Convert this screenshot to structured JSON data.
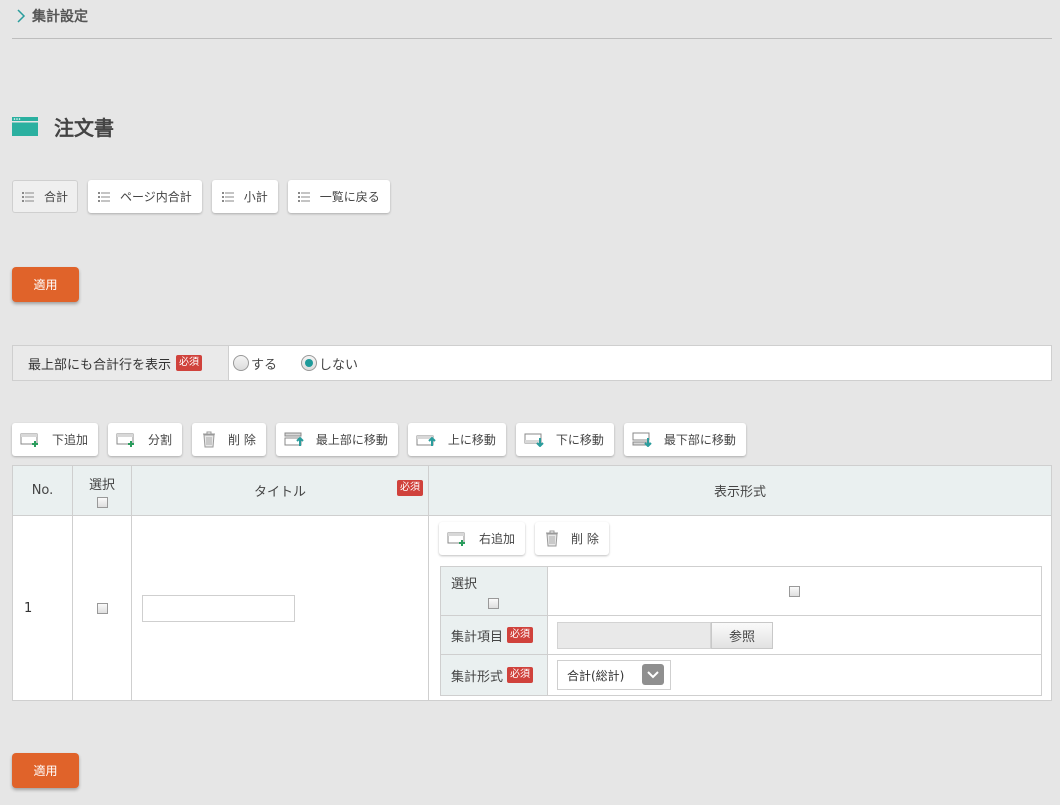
{
  "breadcrumb": {
    "label": "集計設定"
  },
  "page": {
    "title": "注文書"
  },
  "tabs": [
    {
      "label": "合計"
    },
    {
      "label": "ページ内合計"
    },
    {
      "label": "小計"
    },
    {
      "label": "一覧に戻る"
    }
  ],
  "apply_label": "適用",
  "required_label": "必須",
  "setting": {
    "label": "最上部にも合計行を表示",
    "options": [
      "する",
      "しない"
    ],
    "selected": "しない"
  },
  "toolbar": {
    "add_below": "下追加",
    "split": "分割",
    "delete": "削 除",
    "move_top": "最上部に移動",
    "move_up": "上に移動",
    "move_down": "下に移動",
    "move_bottom": "最下部に移動"
  },
  "grid": {
    "headers": {
      "no": "No.",
      "select": "選択",
      "title": "タイトル",
      "format": "表示形式"
    },
    "rows": [
      {
        "no": "1",
        "title_value": "",
        "format": {
          "add_right": "右追加",
          "delete": "削 除",
          "select_label": "選択",
          "item_label": "集計項目",
          "ref_button": "参照",
          "format_label": "集計形式",
          "format_value": "合計(総計)"
        }
      }
    ]
  },
  "colors": {
    "accent": "#e0632a",
    "teal": "#1e9a9a",
    "required": "#d0423c"
  }
}
